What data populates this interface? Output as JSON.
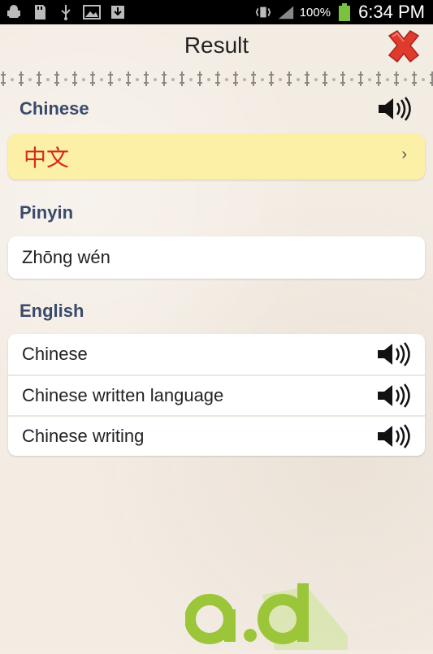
{
  "status_bar": {
    "battery": "100%",
    "time": "6:34 PM"
  },
  "header": {
    "title": "Result"
  },
  "chinese": {
    "label": "Chinese",
    "value": "中文"
  },
  "pinyin": {
    "label": "Pinyin",
    "value": "Zhōng wén"
  },
  "english": {
    "label": "English",
    "items": [
      {
        "text": "Chinese"
      },
      {
        "text": "Chinese written language"
      },
      {
        "text": "Chinese writing"
      }
    ]
  },
  "colors": {
    "section_label": "#3a4a6b",
    "chinese_text": "#d62c1a",
    "highlight_card": "#fbf0a6",
    "close_red": "#e03a2c",
    "logo_green": "#9bc63a"
  }
}
